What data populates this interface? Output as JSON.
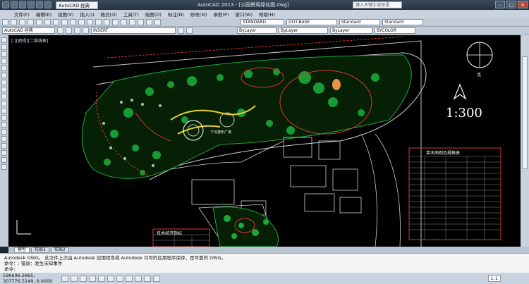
{
  "app": {
    "title": "AutoCAD 2013 - [公园景观绿化图.dwg]",
    "workspace": "AutoCAD 经典",
    "help_search_placeholder": "键入关键字或短语"
  },
  "menu": [
    "文件(F)",
    "编辑(E)",
    "视图(V)",
    "插入(I)",
    "格式(O)",
    "工具(T)",
    "绘图(D)",
    "标注(N)",
    "修改(M)",
    "参数(P)",
    "窗口(W)",
    "帮助(H)"
  ],
  "toolbar_row1": {
    "text_style": "STANDARD",
    "dim_style": "DOT-BASE",
    "table_style": "Standard",
    "multileader_style": "Standard"
  },
  "toolbar_row2": {
    "workspace": "AutoCAD 经典",
    "layer": "INSERT",
    "color": "ByLayer",
    "linetype": "ByLayer",
    "plotstyle": "BYCOLOR"
  },
  "drawing": {
    "viewport_label": "[-][俯视][二维线框]",
    "scale_text": "1:300",
    "north_label": "北",
    "plan_label_1": "下沉游乐广场",
    "table_title_right": "苗木图例及规格表",
    "table_title_bottom": "技术经济指标"
  },
  "tabs": [
    "模型",
    "布局1",
    "布局2"
  ],
  "command": {
    "line1": "Autodesk DWG。 此文件上次由 Autodesk 应用程序或 Autodesk 许可的应用程序保存，是可靠的 DWG。",
    "line2": "命令：; 错误：发生未知事件",
    "prompt": "命令："
  },
  "status": {
    "coords": "596696.2865, 307776.5149, 0.0000",
    "zoom": "1:1"
  },
  "colors": {
    "background": "#000000",
    "green": "#1aa83a",
    "red": "#d23a2a",
    "yellow": "#e8d21d",
    "white": "#ffffff"
  }
}
